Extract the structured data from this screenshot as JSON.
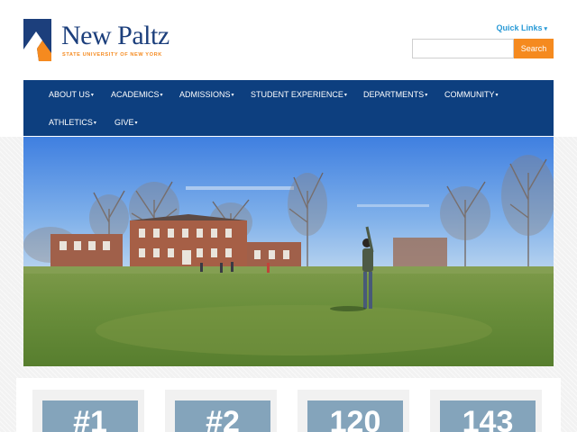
{
  "header": {
    "logo": {
      "icon": "new-paltz-logo-mark",
      "name": "New Paltz",
      "subtitle": "STATE UNIVERSITY OF NEW YORK",
      "colors": {
        "navy": "#1c3f7c",
        "orange": "#f58a1f"
      }
    },
    "quick_links": {
      "label": "Quick Links",
      "icon": "caret-down-icon"
    },
    "search": {
      "placeholder": "",
      "value": "",
      "button_label": "Search"
    }
  },
  "nav": {
    "background": "#0d3f7f",
    "items": [
      {
        "label": "ABOUT US"
      },
      {
        "label": "ACADEMICS"
      },
      {
        "label": "ADMISSIONS"
      },
      {
        "label": "STUDENT EXPERIENCE"
      },
      {
        "label": "DEPARTMENTS"
      },
      {
        "label": "COMMUNITY"
      },
      {
        "label": "ATHLETICS"
      },
      {
        "label": "GIVE"
      }
    ]
  },
  "hero": {
    "description_icon": "campus-lawn-photo"
  },
  "stats": [
    {
      "number": "#1"
    },
    {
      "number": "#2"
    },
    {
      "number": "120"
    },
    {
      "number": "143"
    }
  ],
  "colors": {
    "accent": "#f58a1f",
    "link": "#2a9ad6",
    "stat_box": "#84a4bb"
  }
}
